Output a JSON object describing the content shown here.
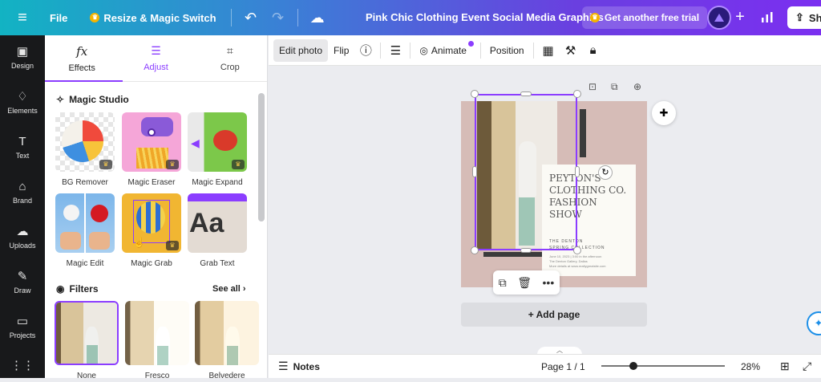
{
  "topbar": {
    "file_label": "File",
    "resize_label": "Resize & Magic Switch",
    "title": "Pink Chic Clothing Event Social Media Graphics",
    "trial_label": "Get another free trial",
    "share_label": "Sh"
  },
  "rail": {
    "items": [
      {
        "label": "Design",
        "icon": "design-icon"
      },
      {
        "label": "Elements",
        "icon": "elements-icon"
      },
      {
        "label": "Text",
        "icon": "text-icon"
      },
      {
        "label": "Brand",
        "icon": "brand-icon"
      },
      {
        "label": "Uploads",
        "icon": "uploads-icon"
      },
      {
        "label": "Draw",
        "icon": "draw-icon"
      },
      {
        "label": "Projects",
        "icon": "projects-icon"
      }
    ]
  },
  "panel": {
    "tabs": [
      {
        "label": "Effects"
      },
      {
        "label": "Adjust"
      },
      {
        "label": "Crop"
      }
    ],
    "magic_studio_title": "Magic Studio",
    "tools": [
      {
        "label": "BG Remover"
      },
      {
        "label": "Magic Eraser"
      },
      {
        "label": "Magic Expand"
      },
      {
        "label": "Magic Edit"
      },
      {
        "label": "Magic Grab"
      },
      {
        "label": "Grab Text"
      }
    ],
    "grab_text_sample": "Aa",
    "filters_title": "Filters",
    "see_all": "See all",
    "filters": [
      {
        "label": "None"
      },
      {
        "label": "Fresco"
      },
      {
        "label": "Belvedere"
      }
    ]
  },
  "toolbar": {
    "edit_photo": "Edit photo",
    "flip": "Flip",
    "animate": "Animate",
    "position": "Position"
  },
  "canvas": {
    "card_title": "PEYTON'S CLOTHING CO. FASHION SHOW",
    "card_sub1": "THE DENTON",
    "card_sub2": "SPRING COLLECTION",
    "card_fine1": "June 10, 2023 | 3:00 in the afternoon",
    "card_fine2": "The Denton Gallery, Dallas",
    "card_fine3": "More details at www.reallygreatsite.com",
    "add_page": "+ Add page"
  },
  "bottombar": {
    "notes": "Notes",
    "page_indicator": "Page 1 / 1",
    "zoom": "28%"
  },
  "colors": {
    "accent": "#8b3dff",
    "rail_bg": "#18191b",
    "page_bg": "#d6bcb7"
  }
}
